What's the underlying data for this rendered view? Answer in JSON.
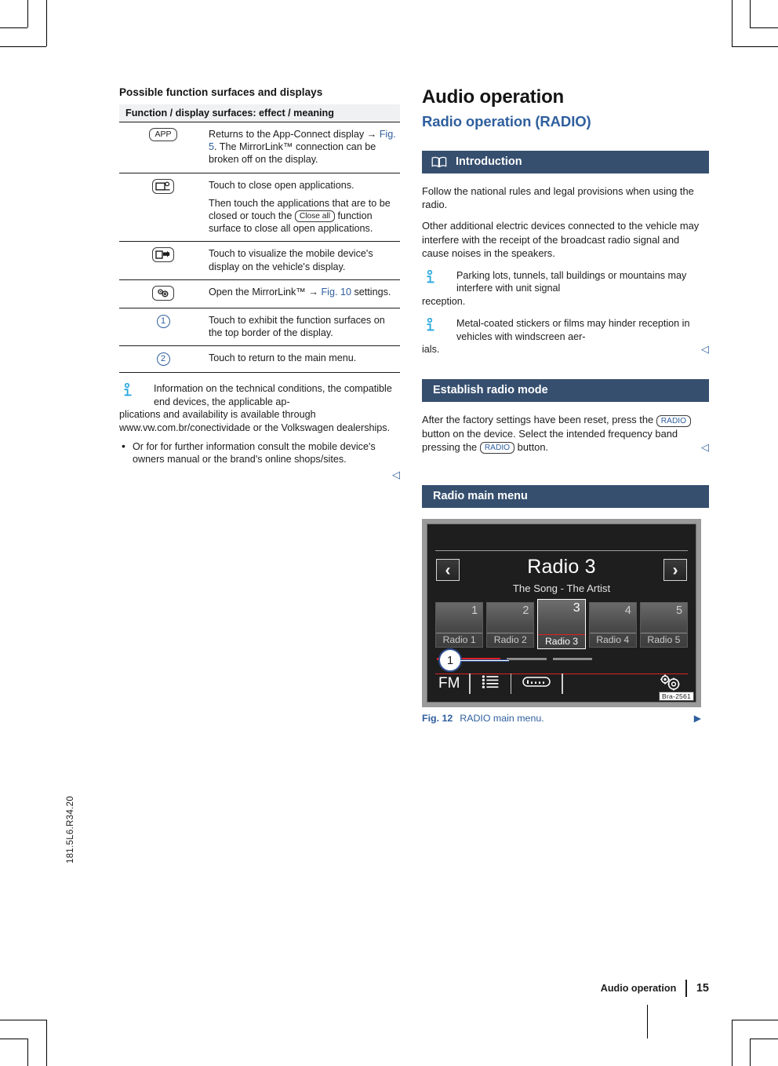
{
  "page": {
    "spine_code": "181.5L6.R34.20",
    "footer_title": "Audio operation",
    "footer_page": "15"
  },
  "left_column": {
    "subhead": "Possible function surfaces and displays",
    "table": {
      "header": "Function / display surfaces: effect / meaning",
      "rows": [
        {
          "symbol_type": "keycap",
          "symbol_label": "APP",
          "symbol_name": "app-key-icon",
          "paragraphs": [
            {
              "segments": [
                {
                  "t": "Returns to the App-Connect display "
                },
                {
                  "t": "→ ",
                  "style": "plain"
                },
                {
                  "t": "Fig. 5",
                  "style": "link"
                },
                {
                  "t": ". The MirrorLink™ connection can be broken off on the display."
                }
              ]
            }
          ]
        },
        {
          "symbol_type": "glyph",
          "symbol_label": "close-apps",
          "symbol_name": "close-applications-icon",
          "paragraphs": [
            {
              "segments": [
                {
                  "t": "Touch to close open applications."
                }
              ]
            },
            {
              "segments": [
                {
                  "t": "Then touch the applications that are to be closed or touch the "
                },
                {
                  "t": "Close all",
                  "style": "keycap"
                },
                {
                  "t": " function surface to close all open applications."
                }
              ]
            }
          ]
        },
        {
          "symbol_type": "glyph",
          "symbol_label": "mirror-display",
          "symbol_name": "mirror-display-icon",
          "paragraphs": [
            {
              "segments": [
                {
                  "t": "Touch to visualize the mobile device's display on the vehicle's display."
                }
              ]
            }
          ]
        },
        {
          "symbol_type": "glyph",
          "symbol_label": "mirrorlink-settings",
          "symbol_name": "mirrorlink-settings-icon",
          "paragraphs": [
            {
              "segments": [
                {
                  "t": "Open the MirrorLink™ "
                },
                {
                  "t": "→ "
                },
                {
                  "t": "Fig. 10",
                  "style": "link"
                },
                {
                  "t": " settings."
                }
              ]
            }
          ]
        },
        {
          "symbol_type": "circnum",
          "symbol_label": "1",
          "symbol_name": "callout-number-1",
          "paragraphs": [
            {
              "segments": [
                {
                  "t": "Touch to exhibit the function surfaces on the top border of the display."
                }
              ]
            }
          ]
        },
        {
          "symbol_type": "circnum",
          "symbol_label": "2",
          "symbol_name": "callout-number-2",
          "paragraphs": [
            {
              "segments": [
                {
                  "t": "Touch to return to the main menu."
                }
              ]
            }
          ]
        }
      ]
    },
    "note": {
      "icon": "info-icon",
      "indent_text": "Information on the technical conditions, the compatible end devices, the applicable ap-",
      "rest_text": "plications and availability is available through www.vw.com.br/conectividade or the Volkswagen dealerships.",
      "bullets": [
        "Or for for further information consult the mobile device's owners manual or the brand's online shops/sites."
      ],
      "endmark": "◁"
    }
  },
  "right_column": {
    "chapter_title": "Audio operation",
    "section_title": "Radio operation (RADIO)",
    "introduction": {
      "bar_label": "Introduction",
      "bar_icon": "book-icon",
      "paragraphs": [
        "Follow the national rules and legal provisions when using the radio.",
        "Other additional electric devices connected to the vehicle may interfere with the receipt of the broadcast radio signal and cause noises in the speakers."
      ],
      "notes": [
        {
          "icon": "info-icon",
          "indent_text": "Parking lots, tunnels, tall buildings or mountains may interfere with unit signal",
          "rest_text": "reception."
        },
        {
          "icon": "info-icon",
          "indent_text": "Metal-coated stickers or films may hinder reception in vehicles with windscreen aer-",
          "rest_text": "ials."
        }
      ],
      "endmark": "◁"
    },
    "establish": {
      "bar_label": "Establish radio mode",
      "text_parts": [
        {
          "t": "After the factory settings have been reset, press the "
        },
        {
          "t": "RADIO",
          "style": "keycap-blue"
        },
        {
          "t": " button on the device. Select the intended frequency band pressing the "
        },
        {
          "t": "RADIO",
          "style": "keycap-blue"
        },
        {
          "t": " button."
        }
      ],
      "endmark": "◁"
    },
    "radio_main_menu": {
      "bar_label": "Radio main menu",
      "figure": {
        "station_name": "Radio 3",
        "song_line": "The Song - The Artist",
        "nav_prev_icon": "chevron-left-icon",
        "nav_next_icon": "chevron-right-icon",
        "presets": [
          {
            "num": "1",
            "name": "Radio 1",
            "active": false
          },
          {
            "num": "2",
            "name": "Radio 2",
            "active": false
          },
          {
            "num": "3",
            "name": "Radio 3",
            "active": true
          },
          {
            "num": "4",
            "name": "Radio 4",
            "active": false
          },
          {
            "num": "5",
            "name": "Radio 5",
            "active": false
          }
        ],
        "callout_number": "1",
        "band_label": "FM",
        "list_icon": "station-list-icon",
        "keypad_icon": "frequency-keypad-icon",
        "settings_icon": "gear-settings-icon",
        "image_code": "Bra-2561"
      },
      "caption_label": "Fig. 12",
      "caption_text": "RADIO main menu.",
      "caption_mark": "▶"
    }
  }
}
